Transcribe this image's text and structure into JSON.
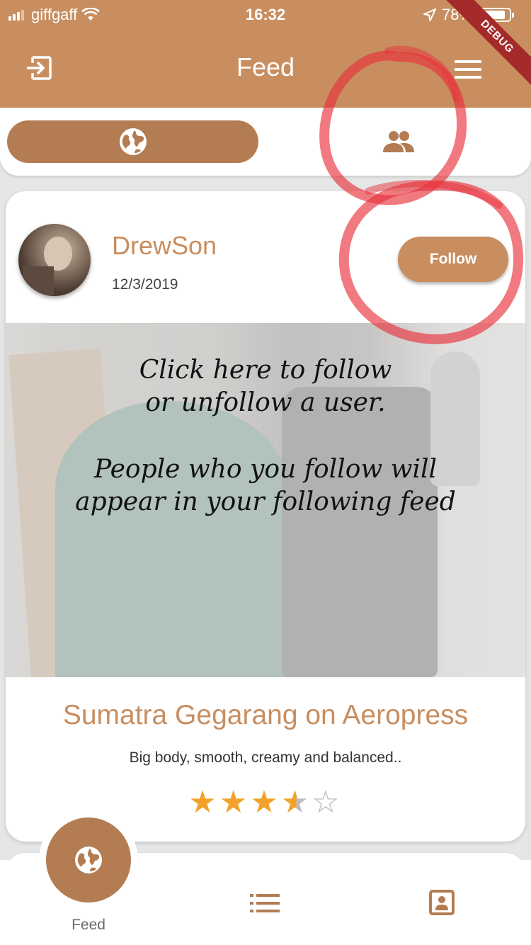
{
  "status_bar": {
    "carrier": "giffgaff",
    "time": "16:32",
    "battery": "78%",
    "debug_banner": "DEBUG"
  },
  "app_bar": {
    "title": "Feed",
    "left_icon": "logout-icon",
    "right_icon": "menu-icon"
  },
  "feed_tabs": [
    {
      "icon": "globe-icon",
      "selected": true
    },
    {
      "icon": "people-icon",
      "selected": false
    }
  ],
  "post": {
    "username": "DrewSon",
    "date": "12/3/2019",
    "follow_label": "Follow",
    "overlay_text_1": [
      "Click here to follow",
      "or unfollow a user."
    ],
    "overlay_text_2": [
      "People who you follow will",
      "appear in your following feed"
    ],
    "title": "Sumatra Gegarang on Aeropress",
    "description": "Big body, smooth,  creamy and  balanced..",
    "rating": 3.5,
    "rating_max": 5
  },
  "bottom_nav": {
    "items": [
      {
        "icon": "globe-icon",
        "label": "Feed",
        "active": true
      },
      {
        "icon": "list-icon",
        "label": "",
        "active": false
      },
      {
        "icon": "profile-icon",
        "label": "",
        "active": false
      }
    ]
  },
  "colors": {
    "primary": "#c88e60",
    "primary_dark": "#b37c52",
    "star": "#f2a22a",
    "annotation": "#e8333c"
  }
}
